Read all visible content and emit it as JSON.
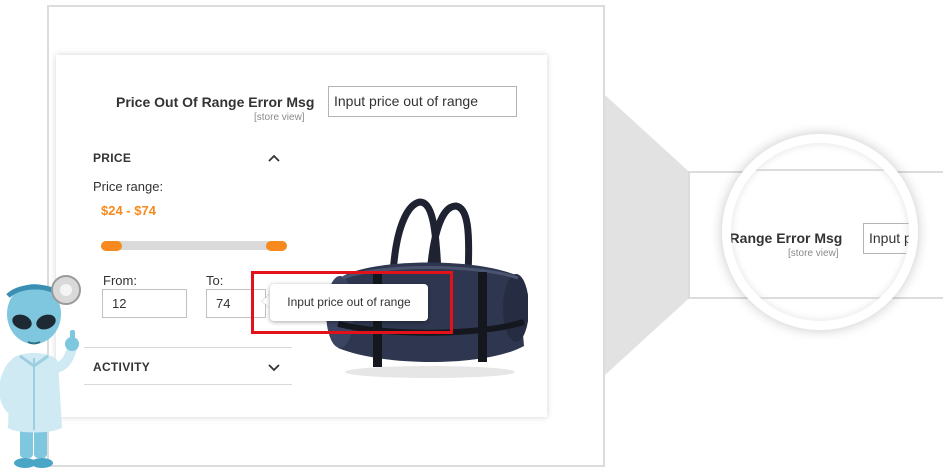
{
  "config": {
    "label": "Price Out Of Range Error Msg",
    "scope": "[store view]",
    "input_value": "Input price out of range"
  },
  "filter": {
    "price_section": {
      "title": "PRICE",
      "range_label": "Price range:",
      "range_value": "$24 - $74",
      "slider_min_fraction": 0.0,
      "slider_max_fraction": 1.0,
      "from_label": "From:",
      "from_value": "12",
      "to_label": "To:",
      "to_value": "74"
    },
    "activity_section": {
      "title": "ACTIVITY"
    }
  },
  "tooltip": {
    "text": "Input price out of range"
  },
  "zoom": {
    "label": "ut Of Range Error Msg",
    "scope": "[store view]",
    "input_value": "Input price"
  },
  "icons": {
    "price_toggle": "chevron-up-icon",
    "activity_toggle": "chevron-down-icon"
  },
  "colors": {
    "accent": "#f68a1e",
    "highlight": "#e3121a",
    "frame": "#dcdcdc"
  }
}
